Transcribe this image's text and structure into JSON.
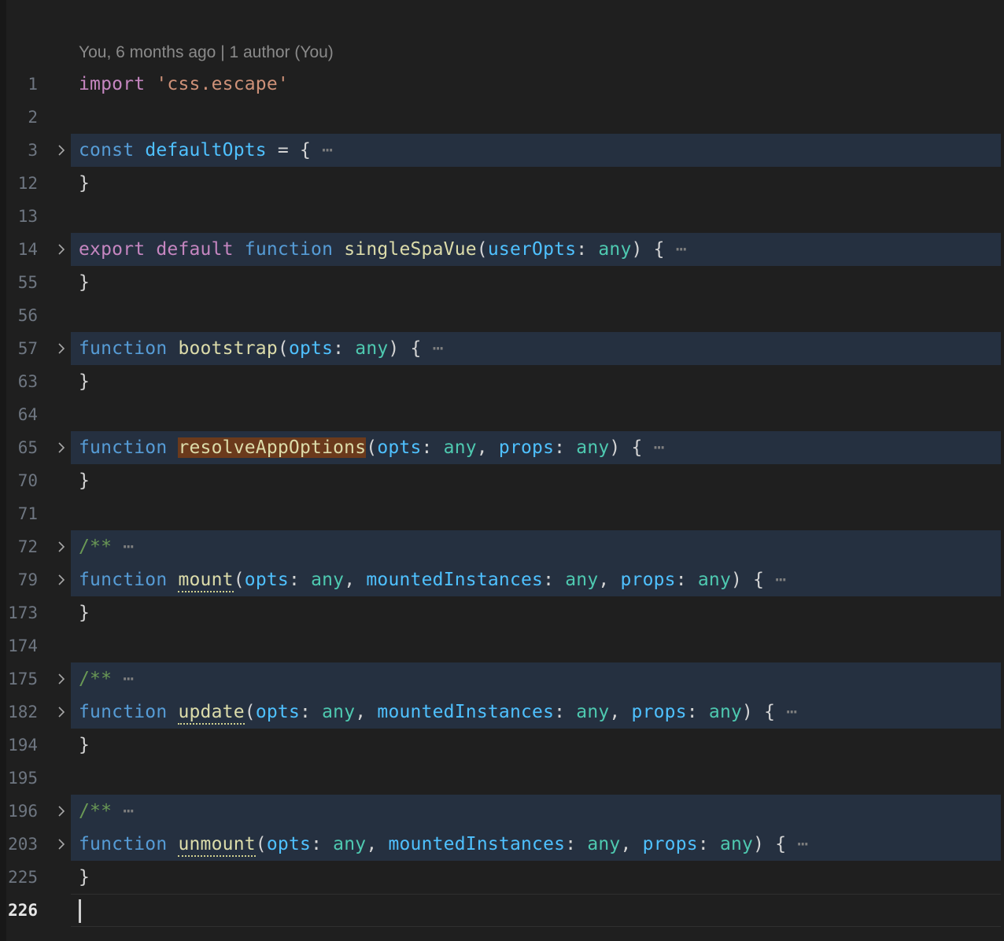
{
  "editor": {
    "theme_colors": {
      "background": "#1f1f1f",
      "folded_region": "#253040",
      "search_match": "#6b3a1c",
      "line_number": "#6e7681",
      "active_line_number": "#e6e6e6",
      "keyword_blue": "#569cd6",
      "keyword_pink": "#c586c0",
      "variable_blue": "#4fc1ff",
      "function_yellow": "#dcdcaa",
      "type_teal": "#4ec9b0",
      "string_orange": "#ce9178",
      "comment_green": "#6a9955"
    },
    "blame_annotation": "You, 6 months ago | 1 author (You)",
    "fold_placeholder": "⋯",
    "fold_chevron_icon": "chevron-right-icon",
    "cursor_line": 226,
    "search_match_text": "resolveAppOptions",
    "lines": [
      {
        "number": 1,
        "folded": false,
        "has_fold_chevron": false,
        "tokens": [
          {
            "text": "import",
            "kind": "kw2"
          },
          {
            "text": " ",
            "kind": "punct"
          },
          {
            "text": "'css.escape'",
            "kind": "str"
          }
        ]
      },
      {
        "number": 2,
        "folded": false,
        "has_fold_chevron": false,
        "tokens": []
      },
      {
        "number": 3,
        "folded": true,
        "has_fold_chevron": true,
        "tokens": [
          {
            "text": "const",
            "kind": "kw"
          },
          {
            "text": " ",
            "kind": "punct"
          },
          {
            "text": "defaultOpts",
            "kind": "var"
          },
          {
            "text": " = { ",
            "kind": "punct"
          },
          {
            "text": "⋯",
            "kind": "dots"
          }
        ]
      },
      {
        "number": 12,
        "folded": false,
        "has_fold_chevron": false,
        "tokens": [
          {
            "text": "}",
            "kind": "punct"
          }
        ]
      },
      {
        "number": 13,
        "folded": false,
        "has_fold_chevron": false,
        "tokens": []
      },
      {
        "number": 14,
        "folded": true,
        "has_fold_chevron": true,
        "tokens": [
          {
            "text": "export",
            "kind": "kw2"
          },
          {
            "text": " ",
            "kind": "punct"
          },
          {
            "text": "default",
            "kind": "kw2"
          },
          {
            "text": " ",
            "kind": "punct"
          },
          {
            "text": "function",
            "kind": "kw"
          },
          {
            "text": " ",
            "kind": "punct"
          },
          {
            "text": "singleSpaVue",
            "kind": "fn"
          },
          {
            "text": "(",
            "kind": "punct"
          },
          {
            "text": "userOpts",
            "kind": "var"
          },
          {
            "text": ": ",
            "kind": "punct"
          },
          {
            "text": "any",
            "kind": "type"
          },
          {
            "text": ") { ",
            "kind": "punct"
          },
          {
            "text": "⋯",
            "kind": "dots"
          }
        ]
      },
      {
        "number": 55,
        "folded": false,
        "has_fold_chevron": false,
        "tokens": [
          {
            "text": "}",
            "kind": "punct"
          }
        ]
      },
      {
        "number": 56,
        "folded": false,
        "has_fold_chevron": false,
        "tokens": []
      },
      {
        "number": 57,
        "folded": true,
        "has_fold_chevron": true,
        "tokens": [
          {
            "text": "function",
            "kind": "kw"
          },
          {
            "text": " ",
            "kind": "punct"
          },
          {
            "text": "bootstrap",
            "kind": "fn"
          },
          {
            "text": "(",
            "kind": "punct"
          },
          {
            "text": "opts",
            "kind": "var"
          },
          {
            "text": ": ",
            "kind": "punct"
          },
          {
            "text": "any",
            "kind": "type"
          },
          {
            "text": ") { ",
            "kind": "punct"
          },
          {
            "text": "⋯",
            "kind": "dots"
          }
        ]
      },
      {
        "number": 63,
        "folded": false,
        "has_fold_chevron": false,
        "tokens": [
          {
            "text": "}",
            "kind": "punct"
          }
        ]
      },
      {
        "number": 64,
        "folded": false,
        "has_fold_chevron": false,
        "tokens": []
      },
      {
        "number": 65,
        "folded": true,
        "has_fold_chevron": true,
        "tokens": [
          {
            "text": "function",
            "kind": "kw"
          },
          {
            "text": " ",
            "kind": "punct"
          },
          {
            "text": "resolveAppOptions",
            "kind": "fn",
            "highlight": true
          },
          {
            "text": "(",
            "kind": "punct"
          },
          {
            "text": "opts",
            "kind": "var"
          },
          {
            "text": ": ",
            "kind": "punct"
          },
          {
            "text": "any",
            "kind": "type"
          },
          {
            "text": ", ",
            "kind": "punct"
          },
          {
            "text": "props",
            "kind": "var"
          },
          {
            "text": ": ",
            "kind": "punct"
          },
          {
            "text": "any",
            "kind": "type"
          },
          {
            "text": ") { ",
            "kind": "punct"
          },
          {
            "text": "⋯",
            "kind": "dots"
          }
        ]
      },
      {
        "number": 70,
        "folded": false,
        "has_fold_chevron": false,
        "tokens": [
          {
            "text": "}",
            "kind": "punct"
          }
        ]
      },
      {
        "number": 71,
        "folded": false,
        "has_fold_chevron": false,
        "tokens": []
      },
      {
        "number": 72,
        "folded": true,
        "has_fold_chevron": true,
        "tokens": [
          {
            "text": "/**",
            "kind": "cmt"
          },
          {
            "text": " ",
            "kind": "punct"
          },
          {
            "text": "⋯",
            "kind": "dots"
          }
        ]
      },
      {
        "number": 79,
        "folded": true,
        "has_fold_chevron": true,
        "tokens": [
          {
            "text": "function",
            "kind": "kw"
          },
          {
            "text": " ",
            "kind": "punct"
          },
          {
            "text": "mount",
            "kind": "fn",
            "dotted": true
          },
          {
            "text": "(",
            "kind": "punct"
          },
          {
            "text": "opts",
            "kind": "var"
          },
          {
            "text": ": ",
            "kind": "punct"
          },
          {
            "text": "any",
            "kind": "type"
          },
          {
            "text": ", ",
            "kind": "punct"
          },
          {
            "text": "mountedInstances",
            "kind": "var"
          },
          {
            "text": ": ",
            "kind": "punct"
          },
          {
            "text": "any",
            "kind": "type"
          },
          {
            "text": ", ",
            "kind": "punct"
          },
          {
            "text": "props",
            "kind": "var"
          },
          {
            "text": ": ",
            "kind": "punct"
          },
          {
            "text": "any",
            "kind": "type"
          },
          {
            "text": ") { ",
            "kind": "punct"
          },
          {
            "text": "⋯",
            "kind": "dots"
          }
        ]
      },
      {
        "number": 173,
        "folded": false,
        "has_fold_chevron": false,
        "tokens": [
          {
            "text": "}",
            "kind": "punct"
          }
        ]
      },
      {
        "number": 174,
        "folded": false,
        "has_fold_chevron": false,
        "tokens": []
      },
      {
        "number": 175,
        "folded": true,
        "has_fold_chevron": true,
        "tokens": [
          {
            "text": "/**",
            "kind": "cmt"
          },
          {
            "text": " ",
            "kind": "punct"
          },
          {
            "text": "⋯",
            "kind": "dots"
          }
        ]
      },
      {
        "number": 182,
        "folded": true,
        "has_fold_chevron": true,
        "tokens": [
          {
            "text": "function",
            "kind": "kw"
          },
          {
            "text": " ",
            "kind": "punct"
          },
          {
            "text": "update",
            "kind": "fn",
            "dotted": true
          },
          {
            "text": "(",
            "kind": "punct"
          },
          {
            "text": "opts",
            "kind": "var"
          },
          {
            "text": ": ",
            "kind": "punct"
          },
          {
            "text": "any",
            "kind": "type"
          },
          {
            "text": ", ",
            "kind": "punct"
          },
          {
            "text": "mountedInstances",
            "kind": "var"
          },
          {
            "text": ": ",
            "kind": "punct"
          },
          {
            "text": "any",
            "kind": "type"
          },
          {
            "text": ", ",
            "kind": "punct"
          },
          {
            "text": "props",
            "kind": "var"
          },
          {
            "text": ": ",
            "kind": "punct"
          },
          {
            "text": "any",
            "kind": "type"
          },
          {
            "text": ") { ",
            "kind": "punct"
          },
          {
            "text": "⋯",
            "kind": "dots"
          }
        ]
      },
      {
        "number": 194,
        "folded": false,
        "has_fold_chevron": false,
        "tokens": [
          {
            "text": "}",
            "kind": "punct"
          }
        ]
      },
      {
        "number": 195,
        "folded": false,
        "has_fold_chevron": false,
        "tokens": []
      },
      {
        "number": 196,
        "folded": true,
        "has_fold_chevron": true,
        "tokens": [
          {
            "text": "/**",
            "kind": "cmt"
          },
          {
            "text": " ",
            "kind": "punct"
          },
          {
            "text": "⋯",
            "kind": "dots"
          }
        ]
      },
      {
        "number": 203,
        "folded": true,
        "has_fold_chevron": true,
        "tokens": [
          {
            "text": "function",
            "kind": "kw"
          },
          {
            "text": " ",
            "kind": "punct"
          },
          {
            "text": "unmount",
            "kind": "fn",
            "dotted": true
          },
          {
            "text": "(",
            "kind": "punct"
          },
          {
            "text": "opts",
            "kind": "var"
          },
          {
            "text": ": ",
            "kind": "punct"
          },
          {
            "text": "any",
            "kind": "type"
          },
          {
            "text": ", ",
            "kind": "punct"
          },
          {
            "text": "mountedInstances",
            "kind": "var"
          },
          {
            "text": ": ",
            "kind": "punct"
          },
          {
            "text": "any",
            "kind": "type"
          },
          {
            "text": ", ",
            "kind": "punct"
          },
          {
            "text": "props",
            "kind": "var"
          },
          {
            "text": ": ",
            "kind": "punct"
          },
          {
            "text": "any",
            "kind": "type"
          },
          {
            "text": ") { ",
            "kind": "punct"
          },
          {
            "text": "⋯",
            "kind": "dots"
          }
        ]
      },
      {
        "number": 225,
        "folded": false,
        "has_fold_chevron": false,
        "tokens": [
          {
            "text": "}",
            "kind": "punct"
          }
        ]
      },
      {
        "number": 226,
        "folded": false,
        "has_fold_chevron": false,
        "active": true,
        "tokens": []
      }
    ]
  }
}
